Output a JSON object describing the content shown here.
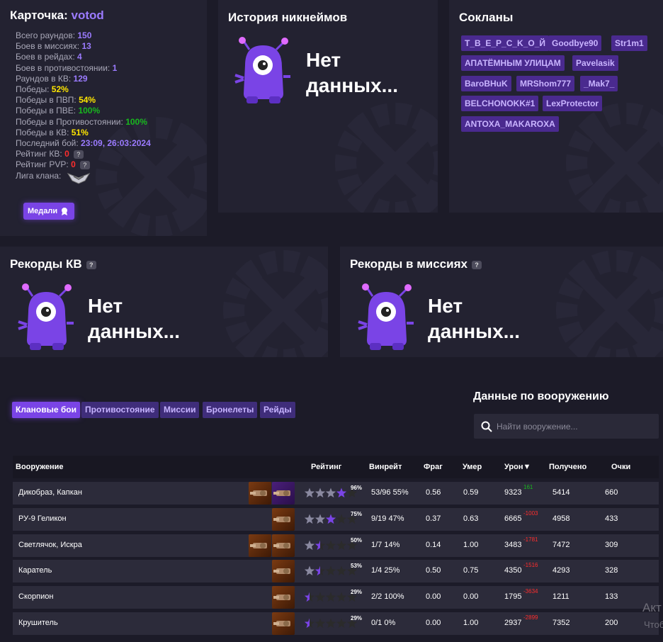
{
  "card": {
    "title_prefix": "Карточка:",
    "nickname": "votod",
    "stats": [
      {
        "label": "Всего раундов:",
        "value": "150",
        "color": "purple"
      },
      {
        "label": "Боев в миссиях:",
        "value": "13",
        "color": "purple"
      },
      {
        "label": "Боев в рейдах:",
        "value": "4",
        "color": "purple"
      },
      {
        "label": "Боев в противостоянии:",
        "value": "1",
        "color": "purple"
      },
      {
        "label": "Раундов в КВ:",
        "value": "129",
        "color": "purple"
      },
      {
        "label": "Победы:",
        "value": "52%",
        "color": "yellow"
      },
      {
        "label": "Победы в ПВП:",
        "value": "54%",
        "color": "yellow"
      },
      {
        "label": "Победы в ПВЕ:",
        "value": "100%",
        "color": "green"
      },
      {
        "label": "Победы в Противостоянии:",
        "value": "100%",
        "color": "green"
      },
      {
        "label": "Победы в КВ:",
        "value": "51%",
        "color": "yellow"
      },
      {
        "label": "Последний бой:",
        "value": "23:09, 26:03:2024",
        "color": "purple"
      },
      {
        "label": "Рейтинг КВ:",
        "value": "0",
        "color": "red",
        "help": true
      },
      {
        "label": "Рейтинг PVP:",
        "value": "0",
        "color": "red",
        "help": true
      },
      {
        "label": "Лига клана:",
        "value": "",
        "color": "none",
        "league_icon": true
      }
    ],
    "medals_button": "Медали"
  },
  "nick_history": {
    "title": "История никнеймов",
    "empty_line1": "Нет",
    "empty_line2": "данных..."
  },
  "clans": {
    "title": "Сокланы",
    "tags": [
      "T_B_E_P_C_K_O_Й",
      "Goodbye90",
      "Str1m1",
      "АПАТЁМНЫМ УЛИЦАМ",
      "Pavelasik",
      "BaroBHuK",
      "MRShom777",
      "_Mak7_",
      "BELCHONOKK#1",
      "LexProtector",
      "ANTOXA_MAKAROXA"
    ]
  },
  "records_kv": {
    "title": "Рекорды КВ",
    "empty_line1": "Нет",
    "empty_line2": "данных..."
  },
  "records_missions": {
    "title": "Рекорды в миссиях",
    "empty_line1": "Нет",
    "empty_line2": "данных..."
  },
  "tabs": [
    "Клановые бои",
    "Противостояние",
    "Миссии",
    "Бронелеты",
    "Рейды"
  ],
  "weapons_panel": {
    "title": "Данные по вооружению",
    "search_placeholder": "Найти вооружение..."
  },
  "table": {
    "headers": [
      "Вооружение",
      "Рейтинг",
      "Винрейт",
      "Фраг",
      "Умер",
      "Урон▼",
      "Получено",
      "Очки"
    ],
    "rows": [
      {
        "name": "Дикобраз, Капкан",
        "rating_pct": "96%",
        "stars": 4,
        "winrate": "53/96 55%",
        "frag": "0.56",
        "died": "0.59",
        "damage": "9323",
        "delta": "161",
        "delta_sign": "pos",
        "received": "5414",
        "points": "660",
        "images": 2
      },
      {
        "name": "РУ-9 Геликон",
        "rating_pct": "75%",
        "stars": 3,
        "winrate": "9/19 47%",
        "frag": "0.37",
        "died": "0.63",
        "damage": "6665",
        "delta": "-1003",
        "delta_sign": "neg",
        "received": "4958",
        "points": "433",
        "images": 1
      },
      {
        "name": "Светлячок, Искра",
        "rating_pct": "50%",
        "stars": 1.5,
        "winrate": "1/7 14%",
        "frag": "0.14",
        "died": "1.00",
        "damage": "3483",
        "delta": "-1781",
        "delta_sign": "neg",
        "received": "7472",
        "points": "309",
        "images": 2
      },
      {
        "name": "Каратель",
        "rating_pct": "53%",
        "stars": 1.5,
        "winrate": "1/4 25%",
        "frag": "0.50",
        "died": "0.75",
        "damage": "4350",
        "delta": "-1516",
        "delta_sign": "neg",
        "received": "4293",
        "points": "328",
        "images": 1
      },
      {
        "name": "Скорпион",
        "rating_pct": "29%",
        "stars": 0.5,
        "winrate": "2/2 100%",
        "frag": "0.00",
        "died": "0.00",
        "damage": "1795",
        "delta": "-3634",
        "delta_sign": "neg",
        "received": "1211",
        "points": "133",
        "images": 1
      },
      {
        "name": "Крушитель",
        "rating_pct": "29%",
        "stars": 0.5,
        "winrate": "0/1 0%",
        "frag": "0.00",
        "died": "1.00",
        "damage": "2937",
        "delta": "-2899",
        "delta_sign": "neg",
        "received": "7352",
        "points": "200",
        "images": 1
      }
    ]
  },
  "watermark": {
    "line1": "Акт",
    "line2": "Чтоб"
  },
  "colors": {
    "accent": "#7a44e6",
    "purple_value": "#9b7bff",
    "yellow": "#ffe600",
    "green": "#18b81e",
    "red": "#ff2d2d",
    "panel": "#232231"
  }
}
